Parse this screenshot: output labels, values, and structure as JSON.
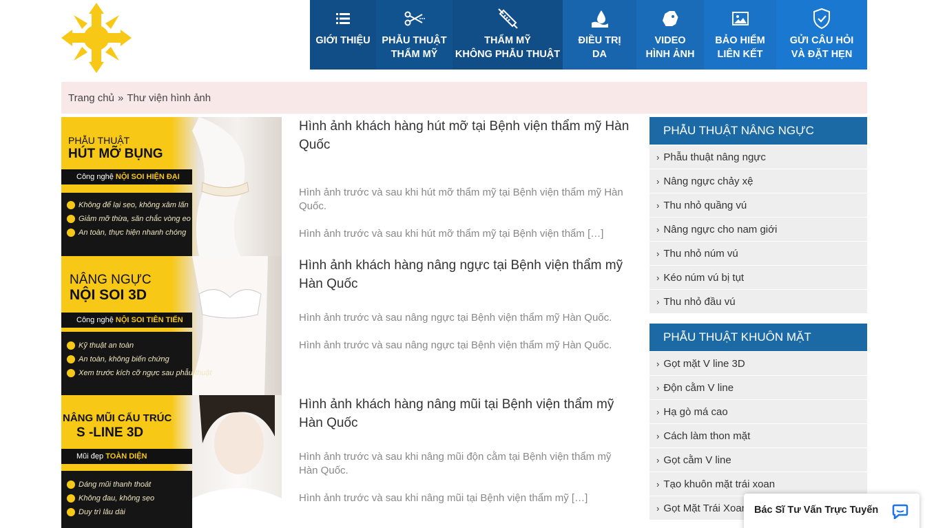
{
  "colors": {
    "nav_dark": "#114d86",
    "nav_light": "#1a73c7",
    "widget_header": "#1c6aa5",
    "brand_yellow": "#f7c815"
  },
  "nav": [
    {
      "icon": "list-icon",
      "line1": "GIỚI THIỆU",
      "line2": ""
    },
    {
      "icon": "scissors-icon",
      "line1": "PHẪU THUẬT",
      "line2": "THẨM MỸ"
    },
    {
      "icon": "syringe-icon",
      "line1": "THẨM MỸ",
      "line2": "KHÔNG PHẪU THUẬT"
    },
    {
      "icon": "drop-icon",
      "line1": "ĐIỀU TRỊ",
      "line2": "DA"
    },
    {
      "icon": "tag-icon",
      "line1": "VIDEO",
      "line2": "HÌNH ẢNH"
    },
    {
      "icon": "picture-icon",
      "line1": "BẢO HIỂM",
      "line2": "LIÊN KẾT"
    },
    {
      "icon": "shield-check-icon",
      "line1": "GỬI CÂU HỎI",
      "line2": "VÀ ĐẶT HẸN"
    }
  ],
  "breadcrumb": {
    "home": "Trang chủ",
    "separator": "»",
    "current": "Thư viện hình ảnh"
  },
  "posts": [
    {
      "title": "Hình ảnh khách hàng hút mỡ tại Bệnh viện thẩm mỹ Hàn Quốc",
      "excerpt1": "Hình ảnh trước và sau khi hút mỡ thẩm mỹ tại Bệnh viện thẩm mỹ Hàn Quốc.",
      "excerpt2": "Hình ảnh trước và sau khi hút mỡ thẩm mỹ tại Bệnh viện thẩm […]",
      "thumb": {
        "line1": "PHẪU THUẬT",
        "line2": "HÚT MỠ BỤNG",
        "strip_prefix": "Công nghệ ",
        "strip_bold": "NỘI SOI HIỆN ĐẠI",
        "bullets": [
          "Không để lại sẹo, không xâm lấn",
          "Giảm mỡ thừa, săn chắc vòng eo",
          "An toàn, thực hiện nhanh chóng"
        ]
      }
    },
    {
      "title": "Hình ảnh khách hàng nâng ngực tại Bệnh viện thẩm mỹ Hàn Quốc",
      "excerpt1": "Hình ảnh trước và sau nâng ngực tại Bệnh viện thẩm mỹ Hàn Quốc.",
      "excerpt2": "Hình ảnh trước và sau nâng ngực tại Bệnh viện thẩm mỹ Hàn Quốc.",
      "thumb": {
        "line1": "NÂNG NGỰC",
        "line2": "NỘI SOI 3D",
        "strip_prefix": "Công nghệ ",
        "strip_bold": "NỘI SOI TIÊN TIẾN",
        "bullets": [
          "Kỹ thuật an toàn",
          "An toàn, không biến chứng",
          "Xem trước kích cỡ ngực sau phẫu thuật"
        ]
      }
    },
    {
      "title": "Hình ảnh khách hàng nâng mũi tại Bệnh viện thẩm mỹ Hàn Quốc",
      "excerpt1": "Hình ảnh trước và sau khi nâng mũi  độn cằm tại Bệnh viện thẩm mỹ Hàn Quốc.",
      "excerpt2": "Hình ảnh trước và sau khi nâng mũi tại Bệnh viện thẩm mỹ […]",
      "thumb": {
        "line1": "NÂNG MŨI CẤU TRÚC",
        "line2": "S -LINE 3D",
        "strip_prefix": "Mũi đẹp ",
        "strip_bold": "TOÀN DIỆN",
        "bullets": [
          "Dáng mũi thanh thoát",
          "Không đau, không sẹo",
          "Duy trì lâu dài"
        ]
      }
    }
  ],
  "sidebar": [
    {
      "title": "PHẪU THUẬT NÂNG NGỰC",
      "items": [
        "Phẫu thuật nâng ngực",
        "Nâng ngực chảy xệ",
        "Thu nhỏ quầng vú",
        "Nâng ngực cho nam giới",
        "Thu nhỏ núm vú",
        "Kéo núm vú bị tụt",
        "Thu nhỏ đầu vú"
      ]
    },
    {
      "title": "PHẪU THUẬT KHUÔN MẶT",
      "items": [
        "Gọt mặt V line 3D",
        "Độn cằm V line",
        "Hạ gò má cao",
        "Cách làm thon mặt",
        "Gọt cằm V line",
        "Tạo khuôn mặt trái xoan",
        "Gọt Mặt Trái Xoan"
      ]
    }
  ],
  "chat": {
    "label": "Bác Sĩ Tư Vấn Trực Tuyến"
  }
}
